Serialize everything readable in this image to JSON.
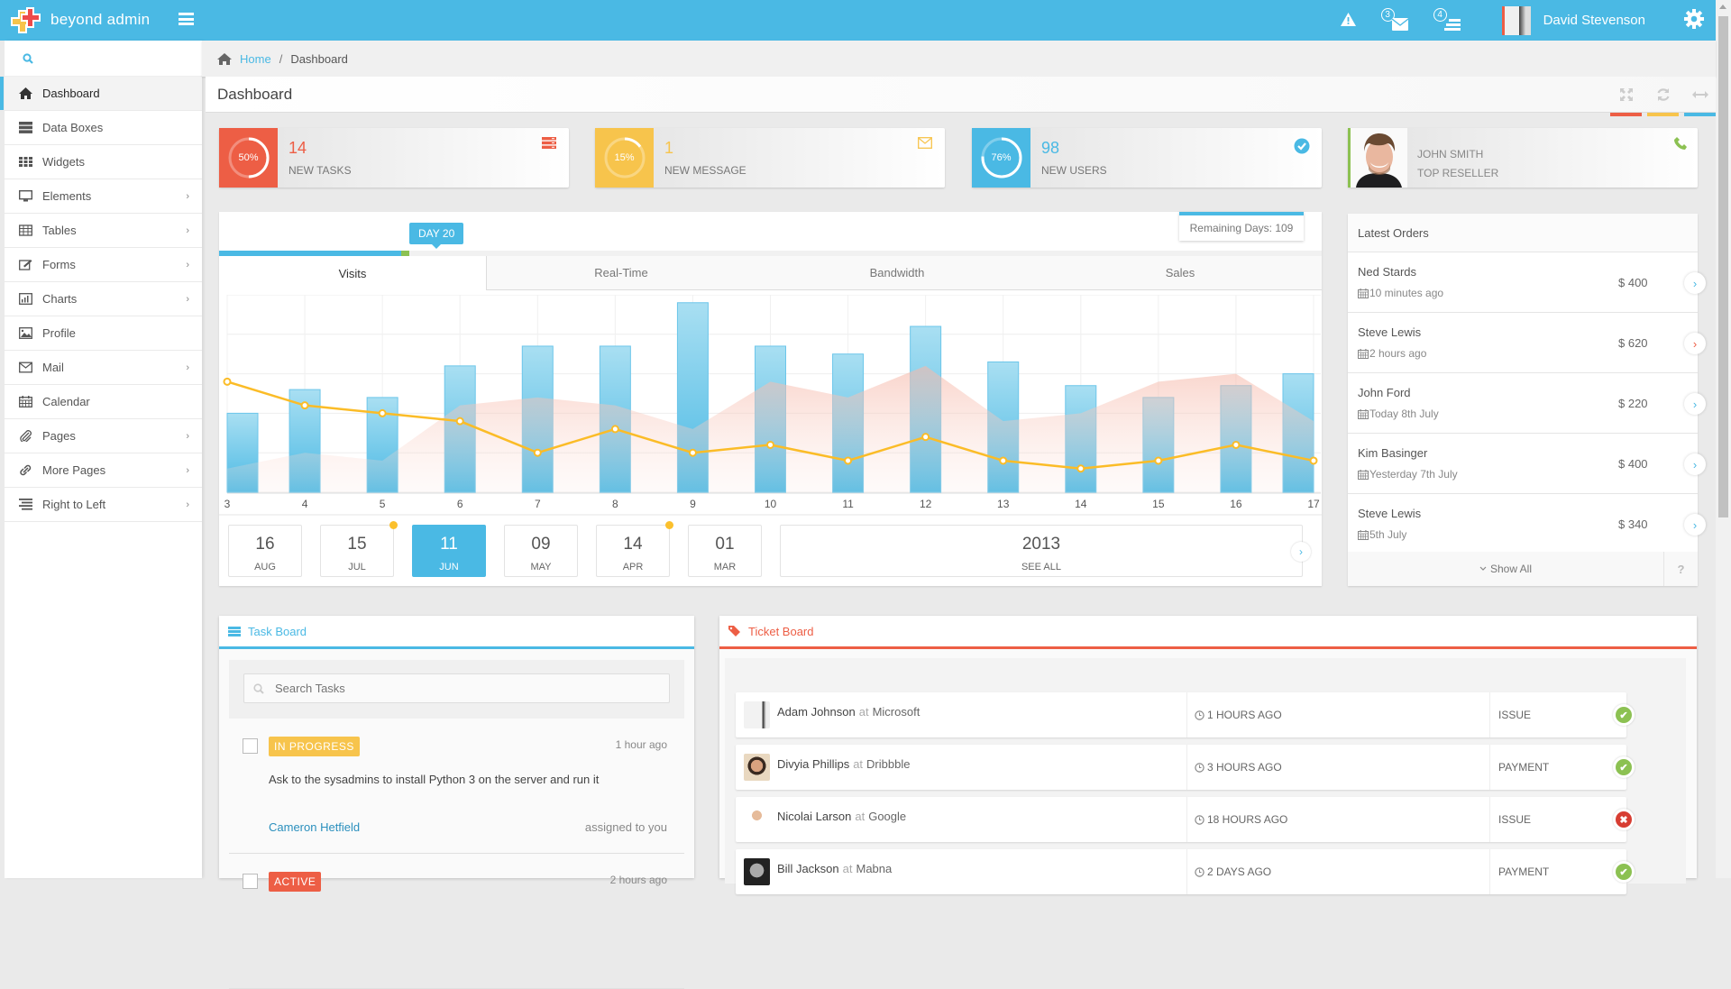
{
  "app": {
    "name": "beyond admin"
  },
  "navbar": {
    "messages_count": "3",
    "tasks_count": "4",
    "user_name": "David Stevenson",
    "icons": [
      "warning-icon",
      "envelope-icon",
      "tasks-icon",
      "gear-icon"
    ]
  },
  "sidebar": {
    "items": [
      {
        "label": "Dashboard",
        "icon": "home-icon",
        "active": true,
        "submenu": false
      },
      {
        "label": "Data Boxes",
        "icon": "data-boxes-icon",
        "active": false,
        "submenu": false
      },
      {
        "label": "Widgets",
        "icon": "widgets-grid-icon",
        "active": false,
        "submenu": false
      },
      {
        "label": "Elements",
        "icon": "desktop-icon",
        "active": false,
        "submenu": true
      },
      {
        "label": "Tables",
        "icon": "table-icon",
        "active": false,
        "submenu": true
      },
      {
        "label": "Forms",
        "icon": "pencil-square-icon",
        "active": false,
        "submenu": true
      },
      {
        "label": "Charts",
        "icon": "bar-chart-icon",
        "active": false,
        "submenu": true
      },
      {
        "label": "Profile",
        "icon": "picture-icon",
        "active": false,
        "submenu": false
      },
      {
        "label": "Mail",
        "icon": "envelope-icon",
        "active": false,
        "submenu": true
      },
      {
        "label": "Calendar",
        "icon": "calendar-icon",
        "active": false,
        "submenu": false
      },
      {
        "label": "Pages",
        "icon": "paperclip-icon",
        "active": false,
        "submenu": true
      },
      {
        "label": "More Pages",
        "icon": "link-icon",
        "active": false,
        "submenu": true
      },
      {
        "label": "Right to Left",
        "icon": "align-right-icon",
        "active": false,
        "submenu": true
      }
    ]
  },
  "breadcrumb": {
    "home": "Home",
    "separator": "/",
    "current": "Dashboard"
  },
  "page": {
    "title": "Dashboard"
  },
  "colors": {
    "primary": "#4ab9e4",
    "danger": "#ed5e45",
    "warning": "#f7c44c",
    "success": "#8cc152"
  },
  "stats": [
    {
      "percent": 50,
      "percent_label": "50%",
      "value": "14",
      "label": "NEW TASKS",
      "color": "#ed5e45",
      "icon": "tasks-icon"
    },
    {
      "percent": 15,
      "percent_label": "15%",
      "value": "1",
      "label": "NEW MESSAGE",
      "color": "#f7c44c",
      "icon": "envelope-icon"
    },
    {
      "percent": 76,
      "percent_label": "76%",
      "value": "98",
      "label": "NEW USERS",
      "color": "#4ab9e4",
      "icon": "check-circle-icon"
    }
  ],
  "reseller": {
    "name": "JOHN SMITH",
    "title": "TOP RESELLER",
    "icon": "phone-icon"
  },
  "progress": {
    "day_label": "DAY 20",
    "fraction": 0.165,
    "remaining_label": "Remaining Days: 109"
  },
  "tabs": [
    {
      "label": "Visits",
      "active": true
    },
    {
      "label": "Real-Time",
      "active": false
    },
    {
      "label": "Bandwidth",
      "active": false
    },
    {
      "label": "Sales",
      "active": false
    }
  ],
  "chart_data": {
    "type": "bar",
    "title": "",
    "xlabel": "",
    "ylabel": "",
    "categories": [
      "3",
      "4",
      "5",
      "6",
      "7",
      "8",
      "9",
      "10",
      "11",
      "12",
      "13",
      "14",
      "15",
      "16",
      "17"
    ],
    "ylim": [
      0,
      50
    ],
    "grid": true,
    "legend": "none",
    "series": [
      {
        "name": "bars",
        "type": "bar",
        "color": "#4ab9e4",
        "values": [
          20,
          26,
          24,
          32,
          37,
          37,
          48,
          37,
          35,
          42,
          33,
          27,
          24,
          27,
          30
        ]
      },
      {
        "name": "line",
        "type": "line",
        "color": "#fbbc27",
        "values": [
          28,
          22,
          20,
          18,
          10,
          16,
          10,
          12,
          8,
          14,
          8,
          6,
          8,
          12,
          8
        ]
      },
      {
        "name": "area",
        "type": "area",
        "color": "#f9c4b8",
        "values": [
          6,
          10,
          8,
          22,
          24,
          22,
          16,
          28,
          24,
          32,
          18,
          20,
          28,
          30,
          18
        ]
      }
    ]
  },
  "dates": [
    {
      "day": "16",
      "month": "AUG",
      "active": false,
      "dot": false
    },
    {
      "day": "15",
      "month": "JUL",
      "active": false,
      "dot": true
    },
    {
      "day": "11",
      "month": "JUN",
      "active": true,
      "dot": false
    },
    {
      "day": "09",
      "month": "MAY",
      "active": false,
      "dot": false
    },
    {
      "day": "14",
      "month": "APR",
      "active": false,
      "dot": true
    },
    {
      "day": "01",
      "month": "MAR",
      "active": false,
      "dot": false
    }
  ],
  "year_box": {
    "year": "2013",
    "label": "SEE ALL"
  },
  "orders": {
    "title": "Latest Orders",
    "items": [
      {
        "name": "Ned Stards",
        "time": "10 minutes ago",
        "price": "$ 400",
        "arrow_color": "#4ab9e4"
      },
      {
        "name": "Steve Lewis",
        "time": "2 hours ago",
        "price": "$ 620",
        "arrow_color": "#ed5e45"
      },
      {
        "name": "John Ford",
        "time": "Today 8th July",
        "price": "$ 220",
        "arrow_color": "#4ab9e4"
      },
      {
        "name": "Kim Basinger",
        "time": "Yesterday 7th July",
        "price": "$ 400",
        "arrow_color": "#4ab9e4"
      },
      {
        "name": "Steve Lewis",
        "time": "5th July",
        "price": "$ 340",
        "arrow_color": "#4ab9e4"
      }
    ],
    "show_all": "Show All",
    "help": "?"
  },
  "task_board": {
    "title": "Task Board",
    "search_placeholder": "Search Tasks",
    "tasks": [
      {
        "status": "IN PROGRESS",
        "status_color": "#f7c44c",
        "time": "1 hour ago",
        "text": "Ask to the sysadmins to install Python 3 on the server and run it",
        "user": "Cameron Hetfield",
        "assigned": "assigned to you"
      },
      {
        "status": "ACTIVE",
        "status_color": "#ed5e45",
        "time": "2 hours ago",
        "text": "",
        "user": "",
        "assigned": ""
      }
    ]
  },
  "ticket_board": {
    "title": "Ticket Board",
    "tickets": [
      {
        "name": "Adam Johnson",
        "at": "at",
        "company": "Microsoft",
        "time": "1 HOURS AGO",
        "type": "ISSUE",
        "status": "done"
      },
      {
        "name": "Divyia Phillips",
        "at": "at",
        "company": "Dribbble",
        "time": "3 HOURS AGO",
        "type": "PAYMENT",
        "status": "done"
      },
      {
        "name": "Nicolai Larson",
        "at": "at",
        "company": "Google",
        "time": "18 HOURS AGO",
        "type": "ISSUE",
        "status": "failed"
      },
      {
        "name": "Bill Jackson",
        "at": "at",
        "company": "Mabna",
        "time": "2 DAYS AGO",
        "type": "PAYMENT",
        "status": "done"
      }
    ]
  }
}
